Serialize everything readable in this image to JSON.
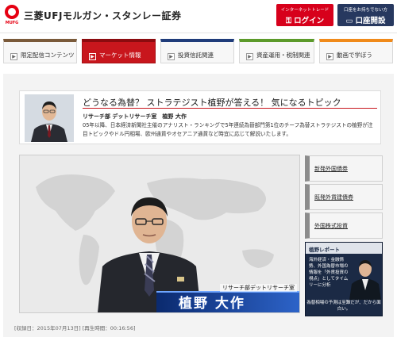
{
  "header": {
    "logo_sub": "MUFG",
    "brand": "三菱UFJモルガン・スタンレー証券",
    "login": {
      "caption": "インターネットトレード",
      "label": "ログイン",
      "icon": "key-icon"
    },
    "open_account": {
      "caption": "口座をお持ちでない方",
      "label": "口座開設",
      "icon": "laptop-icon"
    }
  },
  "nav": {
    "tabs": [
      {
        "label": "限定配信コンテンツ"
      },
      {
        "label": "マーケット情報"
      },
      {
        "label": "投資信託関連"
      },
      {
        "label": "資産運用・税制関連"
      },
      {
        "label": "動画で学ぼう"
      }
    ],
    "arrow_glyph": "▶"
  },
  "main": {
    "title": "どうなる為替？ ストラテジスト植野が答える！ 気になるトピック",
    "analyst": "リサーチ部 デットリサーチ室　植野 大作",
    "description": "05年以降、日本経済新聞社主催のアナリスト・ランキングで5年連続為替部門第1位のチーフ為替ストラテジストの植野が注目トピックやドル円相場、欧州通貨やオセアニア通貨など時宜に応じて解説いたします。",
    "video": {
      "caption_sub": "リサーチ部デットリサーチ室",
      "caption_name": "植野 大作"
    },
    "side_links": [
      {
        "label": "新発外国債券"
      },
      {
        "label": "既発外貨建債券"
      },
      {
        "label": "外国株式投資"
      }
    ],
    "report": {
      "head": "植野レポート",
      "text": "海外経済・金融情勢、外国為替市場の情報を「外貨投資の視点」としてタイムリーに分析",
      "bottom": "為替相場の予測は至難だが、だから面白い。"
    },
    "meta": "[収録日：2015年07月13日] [再生時間：00:16:56]"
  },
  "colors": {
    "brand_red": "#e60012",
    "login_red": "#d7001b",
    "account_navy": "#27385f",
    "active_tab": "#c8161d"
  }
}
